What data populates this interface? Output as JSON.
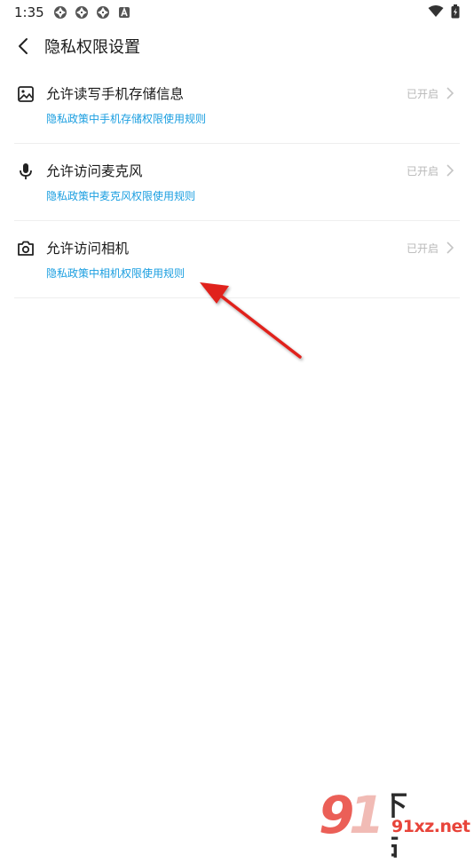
{
  "status_bar": {
    "time": "1:35",
    "notification_icons": [
      "aperture-icon",
      "aperture-icon",
      "aperture-icon",
      "a-letter-icon"
    ],
    "system_icons": [
      "wifi-icon",
      "battery-icon"
    ]
  },
  "header": {
    "title": "隐私权限设置",
    "back_icon": "back-arrow-icon"
  },
  "permissions": [
    {
      "icon": "image-icon",
      "title": "允许读写手机存储信息",
      "status": "已开启",
      "link": "隐私政策中手机存储权限使用规则"
    },
    {
      "icon": "microphone-icon",
      "title": "允许访问麦克风",
      "status": "已开启",
      "link": "隐私政策中麦克风权限使用规则"
    },
    {
      "icon": "camera-icon",
      "title": "允许访问相机",
      "status": "已开启",
      "link": "隐私政策中相机权限使用规则"
    }
  ],
  "watermark": {
    "logo_text": "91下载站",
    "url_text": "91xz.net"
  },
  "colors": {
    "link": "#1a9ee0",
    "status": "#b8b8b8",
    "annotation_arrow": "#e0201c",
    "watermark_red": "#e8443a"
  }
}
